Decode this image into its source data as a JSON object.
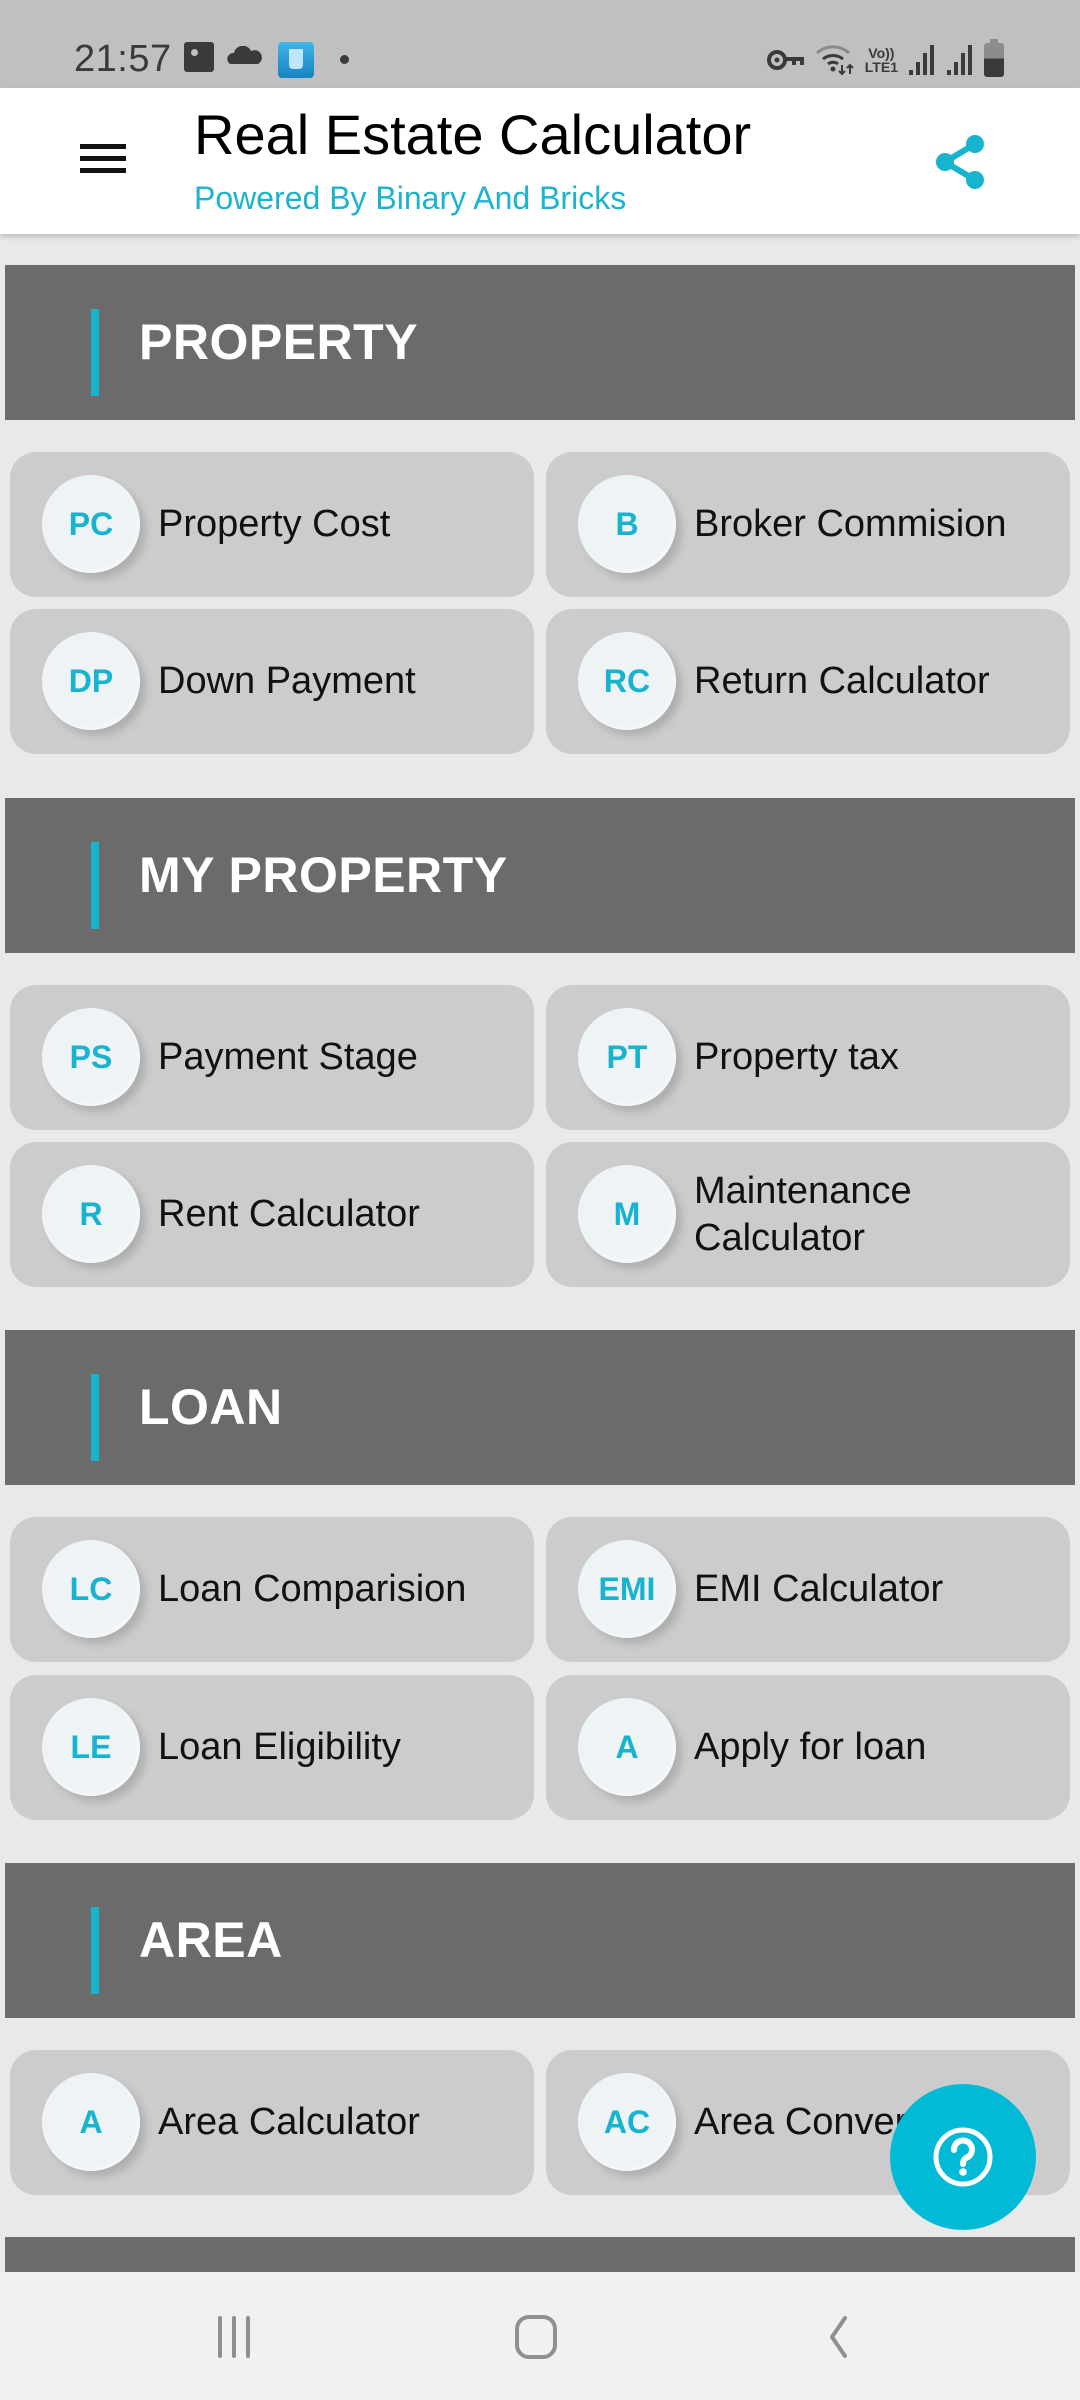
{
  "status_bar": {
    "time": "21:57",
    "left_icons": [
      "gallery-icon",
      "cloud-icon",
      "water-reminder-app-icon",
      "notification-dot-icon"
    ],
    "right_icons": [
      "vpn-key-icon",
      "wifi-icon",
      "volte-lte-icon",
      "signal-sim1-icon",
      "signal-sim2-icon",
      "battery-icon"
    ],
    "lte_top": "Vo))",
    "lte_bottom": "LTE1"
  },
  "app_bar": {
    "title": "Real Estate Calculator",
    "subtitle": "Powered By Binary And Bricks",
    "menu_icon": "hamburger-menu-icon",
    "share_icon": "share-icon"
  },
  "colors": {
    "accent": "#17b3cf",
    "section_header_bg": "#6b6b6b",
    "card_bg": "#cccccc",
    "page_bg": "#e9e9e9",
    "fab_bg": "#02bad6"
  },
  "sections": [
    {
      "title": "PROPERTY",
      "items": [
        {
          "badge": "PC",
          "label": "Property Cost"
        },
        {
          "badge": "B",
          "label": "Broker Commision"
        },
        {
          "badge": "DP",
          "label": "Down Payment"
        },
        {
          "badge": "RC",
          "label": "Return Calculator"
        }
      ]
    },
    {
      "title": "MY PROPERTY",
      "items": [
        {
          "badge": "PS",
          "label": "Payment Stage"
        },
        {
          "badge": "PT",
          "label": "Property tax"
        },
        {
          "badge": "R",
          "label": "Rent Calculator"
        },
        {
          "badge": "M",
          "label": "Maintenance Calculator"
        }
      ]
    },
    {
      "title": "LOAN",
      "items": [
        {
          "badge": "LC",
          "label": "Loan Comparision"
        },
        {
          "badge": "EMI",
          "label": "EMI Calculator"
        },
        {
          "badge": "LE",
          "label": "Loan Eligibility"
        },
        {
          "badge": "A",
          "label": "Apply for loan"
        }
      ]
    },
    {
      "title": "AREA",
      "items": [
        {
          "badge": "A",
          "label": "Area Calculator"
        },
        {
          "badge": "AC",
          "label": "Area Converter"
        }
      ]
    }
  ],
  "fab": {
    "icon": "help-question-icon"
  },
  "nav_bar": {
    "buttons": [
      "recent-apps-icon",
      "home-icon",
      "back-icon"
    ]
  }
}
